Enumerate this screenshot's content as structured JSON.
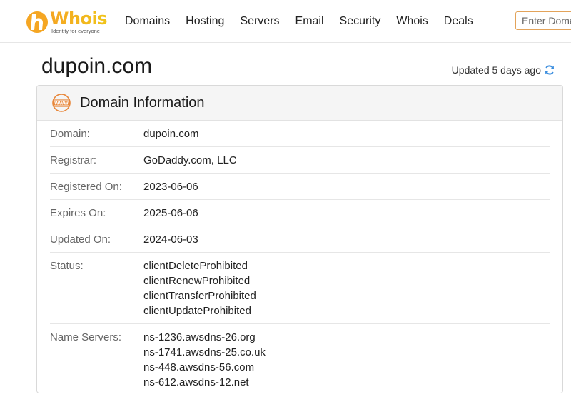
{
  "header": {
    "logo_word": "Whois",
    "logo_tagline": "Identity for everyone",
    "nav": [
      "Domains",
      "Hosting",
      "Servers",
      "Email",
      "Security",
      "Whois",
      "Deals"
    ],
    "search_placeholder": "Enter Domain or IP"
  },
  "page": {
    "title": "dupoin.com",
    "updated_text": "Updated 5 days ago"
  },
  "card": {
    "title": "Domain Information",
    "rows": [
      {
        "label": "Domain:",
        "values": [
          "dupoin.com"
        ]
      },
      {
        "label": "Registrar:",
        "values": [
          "GoDaddy.com, LLC"
        ]
      },
      {
        "label": "Registered On:",
        "values": [
          "2023-06-06"
        ]
      },
      {
        "label": "Expires On:",
        "values": [
          "2025-06-06"
        ]
      },
      {
        "label": "Updated On:",
        "values": [
          "2024-06-03"
        ]
      },
      {
        "label": "Status:",
        "values": [
          "clientDeleteProhibited",
          "clientRenewProhibited",
          "clientTransferProhibited",
          "clientUpdateProhibited"
        ]
      },
      {
        "label": "Name Servers:",
        "values": [
          "ns-1236.awsdns-26.org",
          "ns-1741.awsdns-25.co.uk",
          "ns-448.awsdns-56.com",
          "ns-612.awsdns-12.net"
        ]
      }
    ]
  },
  "colors": {
    "brand_orange": "#f5a623",
    "refresh_blue": "#3a8dde",
    "search_border": "#e3a35a"
  },
  "icons": [
    "whois-logo-icon",
    "www-icon",
    "refresh-icon"
  ]
}
